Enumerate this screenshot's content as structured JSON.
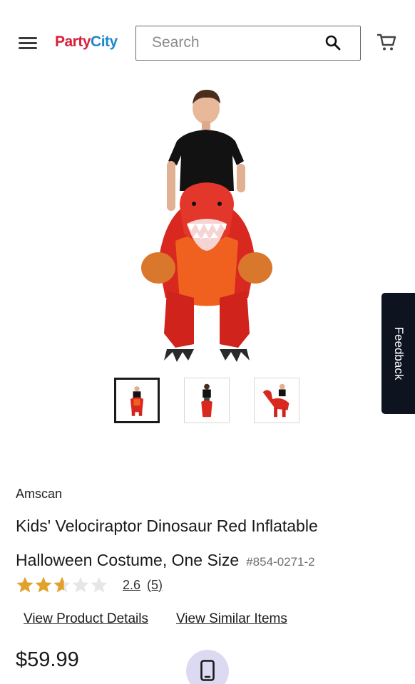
{
  "header": {
    "logo": {
      "part1": "Party",
      "part2": "City"
    },
    "search": {
      "placeholder": "Search",
      "value": ""
    },
    "icons": {
      "menu": "hamburger-menu-icon",
      "search": "search-icon",
      "cart": "cart-icon"
    }
  },
  "gallery": {
    "main_image": "inflatable-dinosaur-costume-image",
    "thumbnails": [
      {
        "name": "front-view",
        "active": true
      },
      {
        "name": "back-view",
        "active": false
      },
      {
        "name": "side-view",
        "active": false
      }
    ]
  },
  "feedback": {
    "label": "Feedback"
  },
  "product": {
    "brand": "Amscan",
    "title_line1": "Kids' Velociraptor Dinosaur Red Inflatable",
    "title_line2": "Halloween Costume, One Size",
    "sku": "#854-0271-2",
    "rating": {
      "value": "2.6",
      "count": "(5)",
      "stars_out_of": 5,
      "stars_filled": 2.6
    },
    "links": {
      "details": "View Product Details",
      "similar": "View Similar Items"
    },
    "price": "$59.99"
  },
  "colors": {
    "star_filled": "#e1a12a",
    "star_empty": "#e6e6e6",
    "feedback_bg": "#0e1320",
    "fab_bg": "#dcdaf2"
  }
}
